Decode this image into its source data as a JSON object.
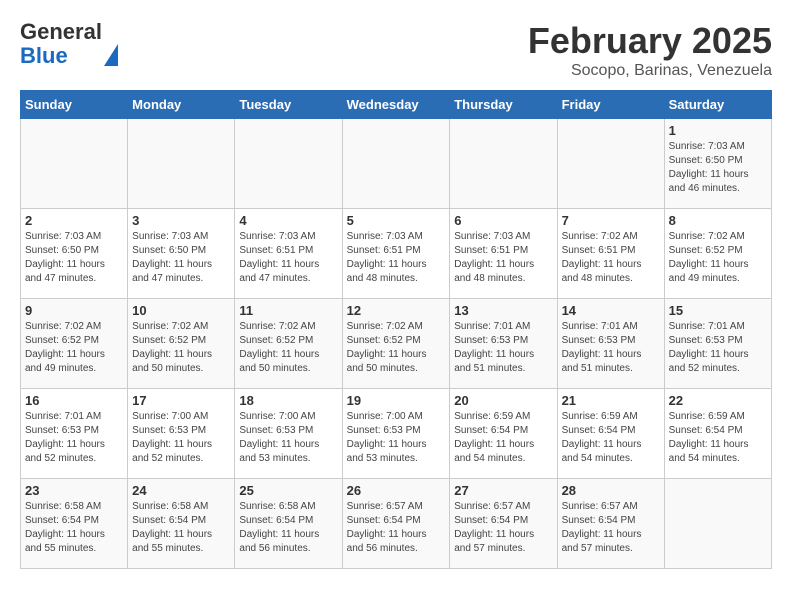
{
  "header": {
    "logo_line1": "General",
    "logo_line2": "Blue",
    "month": "February 2025",
    "location": "Socopo, Barinas, Venezuela"
  },
  "weekdays": [
    "Sunday",
    "Monday",
    "Tuesday",
    "Wednesday",
    "Thursday",
    "Friday",
    "Saturday"
  ],
  "weeks": [
    [
      {
        "day": "",
        "info": ""
      },
      {
        "day": "",
        "info": ""
      },
      {
        "day": "",
        "info": ""
      },
      {
        "day": "",
        "info": ""
      },
      {
        "day": "",
        "info": ""
      },
      {
        "day": "",
        "info": ""
      },
      {
        "day": "1",
        "info": "Sunrise: 7:03 AM\nSunset: 6:50 PM\nDaylight: 11 hours and 46 minutes."
      }
    ],
    [
      {
        "day": "2",
        "info": "Sunrise: 7:03 AM\nSunset: 6:50 PM\nDaylight: 11 hours and 47 minutes."
      },
      {
        "day": "3",
        "info": "Sunrise: 7:03 AM\nSunset: 6:50 PM\nDaylight: 11 hours and 47 minutes."
      },
      {
        "day": "4",
        "info": "Sunrise: 7:03 AM\nSunset: 6:51 PM\nDaylight: 11 hours and 47 minutes."
      },
      {
        "day": "5",
        "info": "Sunrise: 7:03 AM\nSunset: 6:51 PM\nDaylight: 11 hours and 48 minutes."
      },
      {
        "day": "6",
        "info": "Sunrise: 7:03 AM\nSunset: 6:51 PM\nDaylight: 11 hours and 48 minutes."
      },
      {
        "day": "7",
        "info": "Sunrise: 7:02 AM\nSunset: 6:51 PM\nDaylight: 11 hours and 48 minutes."
      },
      {
        "day": "8",
        "info": "Sunrise: 7:02 AM\nSunset: 6:52 PM\nDaylight: 11 hours and 49 minutes."
      }
    ],
    [
      {
        "day": "9",
        "info": "Sunrise: 7:02 AM\nSunset: 6:52 PM\nDaylight: 11 hours and 49 minutes."
      },
      {
        "day": "10",
        "info": "Sunrise: 7:02 AM\nSunset: 6:52 PM\nDaylight: 11 hours and 50 minutes."
      },
      {
        "day": "11",
        "info": "Sunrise: 7:02 AM\nSunset: 6:52 PM\nDaylight: 11 hours and 50 minutes."
      },
      {
        "day": "12",
        "info": "Sunrise: 7:02 AM\nSunset: 6:52 PM\nDaylight: 11 hours and 50 minutes."
      },
      {
        "day": "13",
        "info": "Sunrise: 7:01 AM\nSunset: 6:53 PM\nDaylight: 11 hours and 51 minutes."
      },
      {
        "day": "14",
        "info": "Sunrise: 7:01 AM\nSunset: 6:53 PM\nDaylight: 11 hours and 51 minutes."
      },
      {
        "day": "15",
        "info": "Sunrise: 7:01 AM\nSunset: 6:53 PM\nDaylight: 11 hours and 52 minutes."
      }
    ],
    [
      {
        "day": "16",
        "info": "Sunrise: 7:01 AM\nSunset: 6:53 PM\nDaylight: 11 hours and 52 minutes."
      },
      {
        "day": "17",
        "info": "Sunrise: 7:00 AM\nSunset: 6:53 PM\nDaylight: 11 hours and 52 minutes."
      },
      {
        "day": "18",
        "info": "Sunrise: 7:00 AM\nSunset: 6:53 PM\nDaylight: 11 hours and 53 minutes."
      },
      {
        "day": "19",
        "info": "Sunrise: 7:00 AM\nSunset: 6:53 PM\nDaylight: 11 hours and 53 minutes."
      },
      {
        "day": "20",
        "info": "Sunrise: 6:59 AM\nSunset: 6:54 PM\nDaylight: 11 hours and 54 minutes."
      },
      {
        "day": "21",
        "info": "Sunrise: 6:59 AM\nSunset: 6:54 PM\nDaylight: 11 hours and 54 minutes."
      },
      {
        "day": "22",
        "info": "Sunrise: 6:59 AM\nSunset: 6:54 PM\nDaylight: 11 hours and 54 minutes."
      }
    ],
    [
      {
        "day": "23",
        "info": "Sunrise: 6:58 AM\nSunset: 6:54 PM\nDaylight: 11 hours and 55 minutes."
      },
      {
        "day": "24",
        "info": "Sunrise: 6:58 AM\nSunset: 6:54 PM\nDaylight: 11 hours and 55 minutes."
      },
      {
        "day": "25",
        "info": "Sunrise: 6:58 AM\nSunset: 6:54 PM\nDaylight: 11 hours and 56 minutes."
      },
      {
        "day": "26",
        "info": "Sunrise: 6:57 AM\nSunset: 6:54 PM\nDaylight: 11 hours and 56 minutes."
      },
      {
        "day": "27",
        "info": "Sunrise: 6:57 AM\nSunset: 6:54 PM\nDaylight: 11 hours and 57 minutes."
      },
      {
        "day": "28",
        "info": "Sunrise: 6:57 AM\nSunset: 6:54 PM\nDaylight: 11 hours and 57 minutes."
      },
      {
        "day": "",
        "info": ""
      }
    ]
  ]
}
